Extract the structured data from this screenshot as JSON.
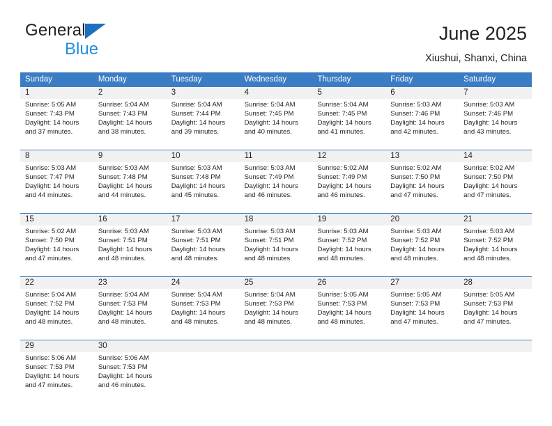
{
  "brand": {
    "name_general": "General",
    "name_blue": "Blue",
    "triangle_color": "#1f6fc0",
    "blue_color": "#1f8fe0"
  },
  "header": {
    "title": "June 2025",
    "subtitle": "Xiushui, Shanxi, China"
  },
  "theme": {
    "header_blue": "#3b7dc4",
    "daynum_band": "#f1f1f1",
    "text": "#231f20"
  },
  "calendar": {
    "day_names": [
      "Sunday",
      "Monday",
      "Tuesday",
      "Wednesday",
      "Thursday",
      "Friday",
      "Saturday"
    ],
    "weeks": [
      [
        {
          "day": "1",
          "sunrise": "Sunrise: 5:05 AM",
          "sunset": "Sunset: 7:43 PM",
          "daylight": "Daylight: 14 hours and 37 minutes."
        },
        {
          "day": "2",
          "sunrise": "Sunrise: 5:04 AM",
          "sunset": "Sunset: 7:43 PM",
          "daylight": "Daylight: 14 hours and 38 minutes."
        },
        {
          "day": "3",
          "sunrise": "Sunrise: 5:04 AM",
          "sunset": "Sunset: 7:44 PM",
          "daylight": "Daylight: 14 hours and 39 minutes."
        },
        {
          "day": "4",
          "sunrise": "Sunrise: 5:04 AM",
          "sunset": "Sunset: 7:45 PM",
          "daylight": "Daylight: 14 hours and 40 minutes."
        },
        {
          "day": "5",
          "sunrise": "Sunrise: 5:04 AM",
          "sunset": "Sunset: 7:45 PM",
          "daylight": "Daylight: 14 hours and 41 minutes."
        },
        {
          "day": "6",
          "sunrise": "Sunrise: 5:03 AM",
          "sunset": "Sunset: 7:46 PM",
          "daylight": "Daylight: 14 hours and 42 minutes."
        },
        {
          "day": "7",
          "sunrise": "Sunrise: 5:03 AM",
          "sunset": "Sunset: 7:46 PM",
          "daylight": "Daylight: 14 hours and 43 minutes."
        }
      ],
      [
        {
          "day": "8",
          "sunrise": "Sunrise: 5:03 AM",
          "sunset": "Sunset: 7:47 PM",
          "daylight": "Daylight: 14 hours and 44 minutes."
        },
        {
          "day": "9",
          "sunrise": "Sunrise: 5:03 AM",
          "sunset": "Sunset: 7:48 PM",
          "daylight": "Daylight: 14 hours and 44 minutes."
        },
        {
          "day": "10",
          "sunrise": "Sunrise: 5:03 AM",
          "sunset": "Sunset: 7:48 PM",
          "daylight": "Daylight: 14 hours and 45 minutes."
        },
        {
          "day": "11",
          "sunrise": "Sunrise: 5:03 AM",
          "sunset": "Sunset: 7:49 PM",
          "daylight": "Daylight: 14 hours and 46 minutes."
        },
        {
          "day": "12",
          "sunrise": "Sunrise: 5:02 AM",
          "sunset": "Sunset: 7:49 PM",
          "daylight": "Daylight: 14 hours and 46 minutes."
        },
        {
          "day": "13",
          "sunrise": "Sunrise: 5:02 AM",
          "sunset": "Sunset: 7:50 PM",
          "daylight": "Daylight: 14 hours and 47 minutes."
        },
        {
          "day": "14",
          "sunrise": "Sunrise: 5:02 AM",
          "sunset": "Sunset: 7:50 PM",
          "daylight": "Daylight: 14 hours and 47 minutes."
        }
      ],
      [
        {
          "day": "15",
          "sunrise": "Sunrise: 5:02 AM",
          "sunset": "Sunset: 7:50 PM",
          "daylight": "Daylight: 14 hours and 47 minutes."
        },
        {
          "day": "16",
          "sunrise": "Sunrise: 5:03 AM",
          "sunset": "Sunset: 7:51 PM",
          "daylight": "Daylight: 14 hours and 48 minutes."
        },
        {
          "day": "17",
          "sunrise": "Sunrise: 5:03 AM",
          "sunset": "Sunset: 7:51 PM",
          "daylight": "Daylight: 14 hours and 48 minutes."
        },
        {
          "day": "18",
          "sunrise": "Sunrise: 5:03 AM",
          "sunset": "Sunset: 7:51 PM",
          "daylight": "Daylight: 14 hours and 48 minutes."
        },
        {
          "day": "19",
          "sunrise": "Sunrise: 5:03 AM",
          "sunset": "Sunset: 7:52 PM",
          "daylight": "Daylight: 14 hours and 48 minutes."
        },
        {
          "day": "20",
          "sunrise": "Sunrise: 5:03 AM",
          "sunset": "Sunset: 7:52 PM",
          "daylight": "Daylight: 14 hours and 48 minutes."
        },
        {
          "day": "21",
          "sunrise": "Sunrise: 5:03 AM",
          "sunset": "Sunset: 7:52 PM",
          "daylight": "Daylight: 14 hours and 48 minutes."
        }
      ],
      [
        {
          "day": "22",
          "sunrise": "Sunrise: 5:04 AM",
          "sunset": "Sunset: 7:52 PM",
          "daylight": "Daylight: 14 hours and 48 minutes."
        },
        {
          "day": "23",
          "sunrise": "Sunrise: 5:04 AM",
          "sunset": "Sunset: 7:53 PM",
          "daylight": "Daylight: 14 hours and 48 minutes."
        },
        {
          "day": "24",
          "sunrise": "Sunrise: 5:04 AM",
          "sunset": "Sunset: 7:53 PM",
          "daylight": "Daylight: 14 hours and 48 minutes."
        },
        {
          "day": "25",
          "sunrise": "Sunrise: 5:04 AM",
          "sunset": "Sunset: 7:53 PM",
          "daylight": "Daylight: 14 hours and 48 minutes."
        },
        {
          "day": "26",
          "sunrise": "Sunrise: 5:05 AM",
          "sunset": "Sunset: 7:53 PM",
          "daylight": "Daylight: 14 hours and 48 minutes."
        },
        {
          "day": "27",
          "sunrise": "Sunrise: 5:05 AM",
          "sunset": "Sunset: 7:53 PM",
          "daylight": "Daylight: 14 hours and 47 minutes."
        },
        {
          "day": "28",
          "sunrise": "Sunrise: 5:05 AM",
          "sunset": "Sunset: 7:53 PM",
          "daylight": "Daylight: 14 hours and 47 minutes."
        }
      ],
      [
        {
          "day": "29",
          "sunrise": "Sunrise: 5:06 AM",
          "sunset": "Sunset: 7:53 PM",
          "daylight": "Daylight: 14 hours and 47 minutes."
        },
        {
          "day": "30",
          "sunrise": "Sunrise: 5:06 AM",
          "sunset": "Sunset: 7:53 PM",
          "daylight": "Daylight: 14 hours and 46 minutes."
        },
        {
          "day": "",
          "sunrise": "",
          "sunset": "",
          "daylight": ""
        },
        {
          "day": "",
          "sunrise": "",
          "sunset": "",
          "daylight": ""
        },
        {
          "day": "",
          "sunrise": "",
          "sunset": "",
          "daylight": ""
        },
        {
          "day": "",
          "sunrise": "",
          "sunset": "",
          "daylight": ""
        },
        {
          "day": "",
          "sunrise": "",
          "sunset": "",
          "daylight": ""
        }
      ]
    ]
  }
}
